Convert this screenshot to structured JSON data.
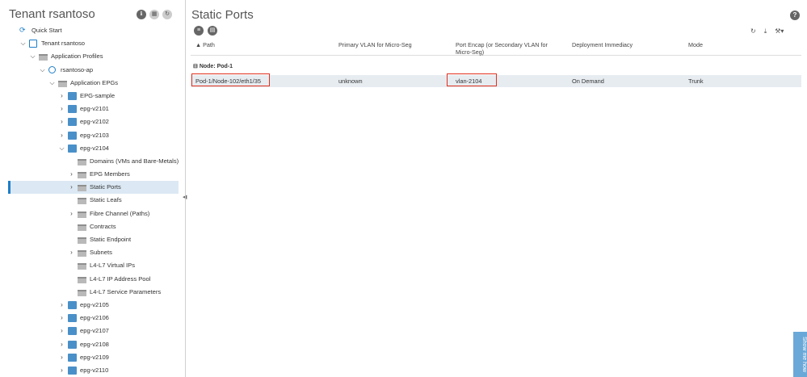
{
  "left_panel": {
    "title": "Tenant rsantoso",
    "tree": [
      {
        "label": "Quick Start",
        "indent": 0,
        "chevron": "",
        "icon": "quick-start"
      },
      {
        "label": "Tenant rsantoso",
        "indent": 1,
        "chevron": "down",
        "icon": "tenant"
      },
      {
        "label": "Application Profiles",
        "indent": 2,
        "chevron": "down",
        "icon": "folder"
      },
      {
        "label": "rsantoso-ap",
        "indent": 3,
        "chevron": "down",
        "icon": "ap"
      },
      {
        "label": "Application EPGs",
        "indent": 4,
        "chevron": "down",
        "icon": "folder"
      },
      {
        "label": "EPG-sample",
        "indent": 5,
        "chevron": "right",
        "icon": "epg"
      },
      {
        "label": "epg-v2101",
        "indent": 5,
        "chevron": "right",
        "icon": "epg"
      },
      {
        "label": "epg-v2102",
        "indent": 5,
        "chevron": "right",
        "icon": "epg"
      },
      {
        "label": "epg-v2103",
        "indent": 5,
        "chevron": "right",
        "icon": "epg"
      },
      {
        "label": "epg-v2104",
        "indent": 5,
        "chevron": "down",
        "icon": "epg"
      },
      {
        "label": "Domains (VMs and Bare-Metals)",
        "indent": 6,
        "chevron": "",
        "icon": "folder"
      },
      {
        "label": "EPG Members",
        "indent": 6,
        "chevron": "right",
        "icon": "folder"
      },
      {
        "label": "Static Ports",
        "indent": 6,
        "chevron": "right",
        "icon": "folder",
        "selected": true
      },
      {
        "label": "Static Leafs",
        "indent": 6,
        "chevron": "",
        "icon": "folder"
      },
      {
        "label": "Fibre Channel (Paths)",
        "indent": 6,
        "chevron": "right",
        "icon": "folder"
      },
      {
        "label": "Contracts",
        "indent": 6,
        "chevron": "",
        "icon": "folder"
      },
      {
        "label": "Static Endpoint",
        "indent": 6,
        "chevron": "",
        "icon": "folder"
      },
      {
        "label": "Subnets",
        "indent": 6,
        "chevron": "right",
        "icon": "folder"
      },
      {
        "label": "L4-L7 Virtual IPs",
        "indent": 6,
        "chevron": "",
        "icon": "folder"
      },
      {
        "label": "L4-L7 IP Address Pool",
        "indent": 6,
        "chevron": "",
        "icon": "folder"
      },
      {
        "label": "L4-L7 Service Parameters",
        "indent": 6,
        "chevron": "",
        "icon": "folder"
      },
      {
        "label": "epg-v2105",
        "indent": 5,
        "chevron": "right",
        "icon": "epg"
      },
      {
        "label": "epg-v2106",
        "indent": 5,
        "chevron": "right",
        "icon": "epg"
      },
      {
        "label": "epg-v2107",
        "indent": 5,
        "chevron": "right",
        "icon": "epg"
      },
      {
        "label": "epg-v2108",
        "indent": 5,
        "chevron": "right",
        "icon": "epg"
      },
      {
        "label": "epg-v2109",
        "indent": 5,
        "chevron": "right",
        "icon": "epg"
      },
      {
        "label": "epg-v2110",
        "indent": 5,
        "chevron": "right",
        "icon": "epg"
      }
    ]
  },
  "main": {
    "title": "Static Ports",
    "help": "?",
    "columns": [
      {
        "label": "▲ Path"
      },
      {
        "label": "Primary VLAN for Micro-Seg"
      },
      {
        "label": "Port Encap (or Secondary VLAN for Micro-Seg)"
      },
      {
        "label": "Deployment Immediacy"
      },
      {
        "label": "Mode"
      }
    ],
    "group_label": "Node: Pod-1",
    "rows": [
      {
        "path": "Pod-1/Node-102/eth1/35",
        "primary_vlan": "unknown",
        "encap": "vlan-2104",
        "immediacy": "On Demand",
        "mode": "Trunk"
      }
    ]
  },
  "show_me": "Show me how"
}
